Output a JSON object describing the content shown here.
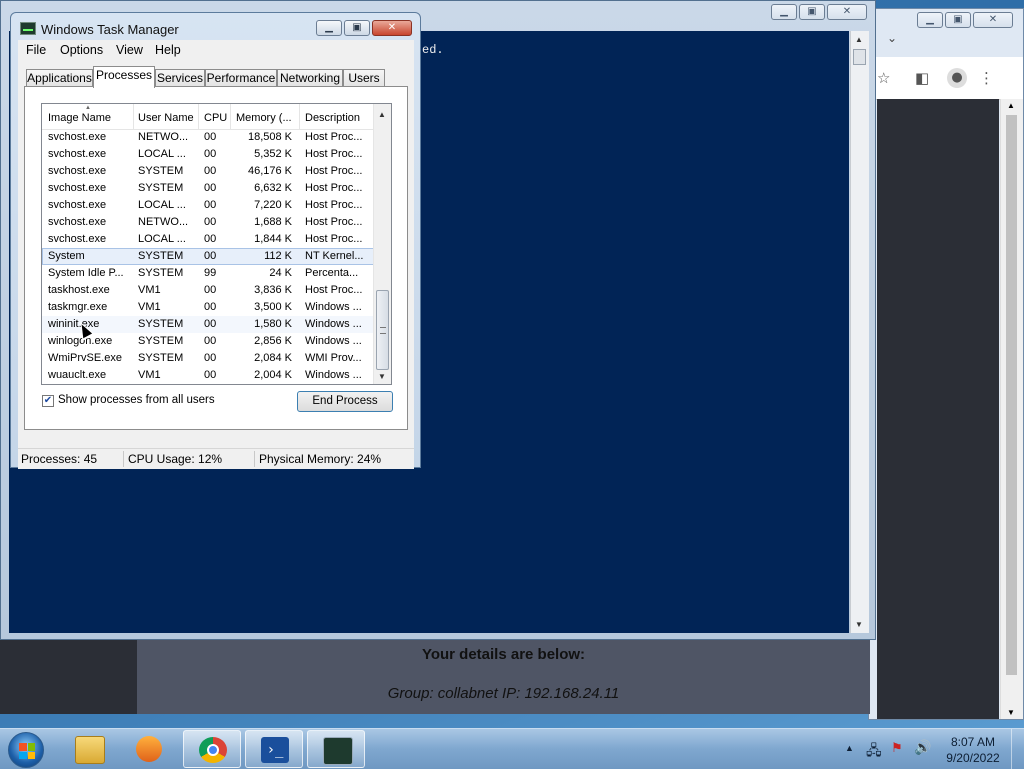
{
  "powershell": {
    "console_line": "ed."
  },
  "browser_page": {
    "heading": "Your details are below:",
    "details": "Group: collabnet   IP: 192.168.24.11"
  },
  "task_manager": {
    "title": "Windows Task Manager",
    "menu": [
      "File",
      "Options",
      "View",
      "Help"
    ],
    "tabs": [
      "Applications",
      "Processes",
      "Services",
      "Performance",
      "Networking",
      "Users"
    ],
    "active_tab": "Processes",
    "columns": [
      "Image Name",
      "User Name",
      "CPU",
      "Memory (...",
      "Description"
    ],
    "rows": [
      [
        "svchost.exe",
        "NETWO...",
        "00",
        "18,508 K",
        "Host Proc..."
      ],
      [
        "svchost.exe",
        "LOCAL ...",
        "00",
        "5,352 K",
        "Host Proc..."
      ],
      [
        "svchost.exe",
        "SYSTEM",
        "00",
        "46,176 K",
        "Host Proc..."
      ],
      [
        "svchost.exe",
        "SYSTEM",
        "00",
        "6,632 K",
        "Host Proc..."
      ],
      [
        "svchost.exe",
        "LOCAL ...",
        "00",
        "7,220 K",
        "Host Proc..."
      ],
      [
        "svchost.exe",
        "NETWO...",
        "00",
        "1,688 K",
        "Host Proc..."
      ],
      [
        "svchost.exe",
        "LOCAL ...",
        "00",
        "1,844 K",
        "Host Proc..."
      ],
      [
        "System",
        "SYSTEM",
        "00",
        "112 K",
        "NT Kernel..."
      ],
      [
        "System Idle P...",
        "SYSTEM",
        "99",
        "24 K",
        "Percenta..."
      ],
      [
        "taskhost.exe",
        "VM1",
        "00",
        "3,836 K",
        "Host Proc..."
      ],
      [
        "taskmgr.exe",
        "VM1",
        "00",
        "3,500 K",
        "Windows ..."
      ],
      [
        "wininit.exe",
        "SYSTEM",
        "00",
        "1,580 K",
        "Windows ..."
      ],
      [
        "winlogon.exe",
        "SYSTEM",
        "00",
        "2,856 K",
        "Windows ..."
      ],
      [
        "WmiPrvSE.exe",
        "SYSTEM",
        "00",
        "2,084 K",
        "WMI Prov..."
      ],
      [
        "wuauclt.exe",
        "VM1",
        "00",
        "2,004 K",
        "Windows ..."
      ]
    ],
    "selected_row_index": 7,
    "hover_row_index": 11,
    "show_all_label": "Show processes from all users",
    "show_all_checked": true,
    "end_process_label": "End Process",
    "status": {
      "processes": "Processes: 45",
      "cpu": "CPU Usage: 12%",
      "memory": "Physical Memory: 24%"
    }
  },
  "taskbar": {
    "time": "8:07 AM",
    "date": "9/20/2022",
    "apps": [
      "explorer",
      "media-player",
      "chrome",
      "powershell",
      "task-manager"
    ]
  }
}
